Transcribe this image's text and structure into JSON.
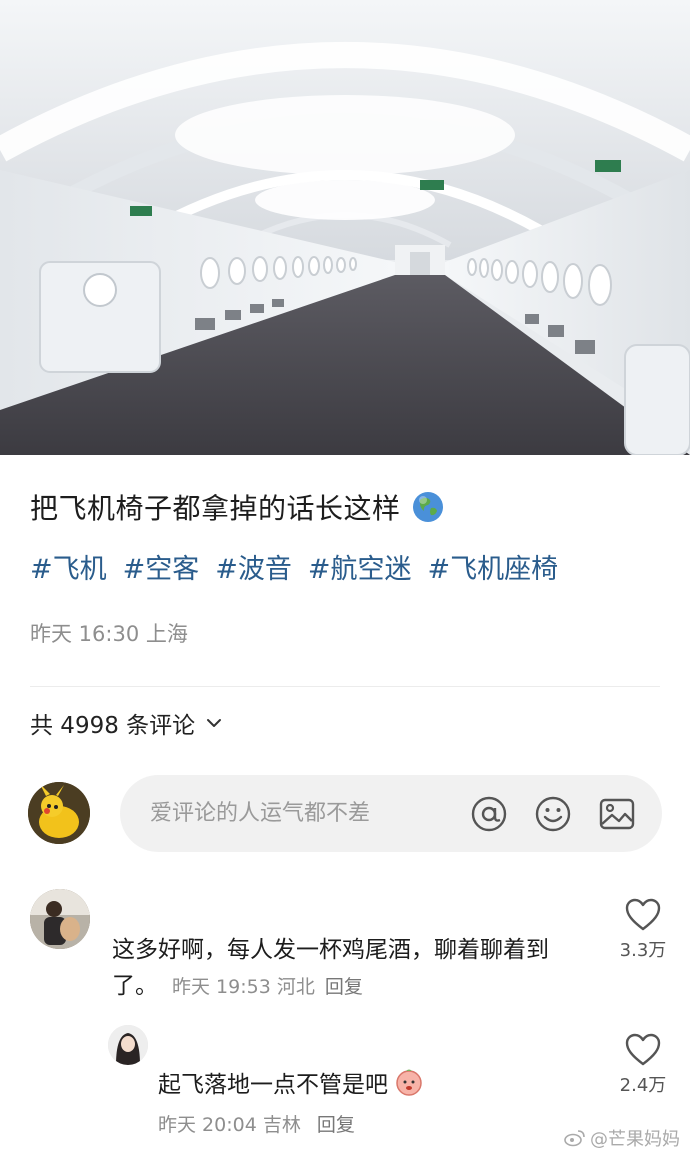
{
  "post": {
    "title": "把飞机椅子都拿掉的话长这样",
    "title_emoji": "globe-icon",
    "tags": [
      "#飞机",
      "#空客",
      "#波音",
      "#航空迷",
      "#飞机座椅"
    ],
    "time": "昨天 16:30",
    "location": "上海",
    "tag_color": "#2a5c8c"
  },
  "comments_header": {
    "label": "共 4998 条评论"
  },
  "composer": {
    "placeholder": "爱评论的人运气都不差",
    "icons": [
      "at-icon",
      "emoji-icon",
      "image-icon"
    ]
  },
  "comments": [
    {
      "text": "这多好啊，每人发一杯鸡尾酒，聊着聊着到了。",
      "time": "昨天 19:53",
      "location": "河北",
      "reply_label": "回复",
      "likes": "3.3万"
    },
    {
      "text": "起飞落地一点不管是吧",
      "emoji": "peach-face-icon",
      "time": "昨天 20:04",
      "location": "吉林",
      "reply_label": "回复",
      "likes": "2.4万"
    }
  ],
  "watermark": {
    "text": "@芒果妈妈"
  }
}
